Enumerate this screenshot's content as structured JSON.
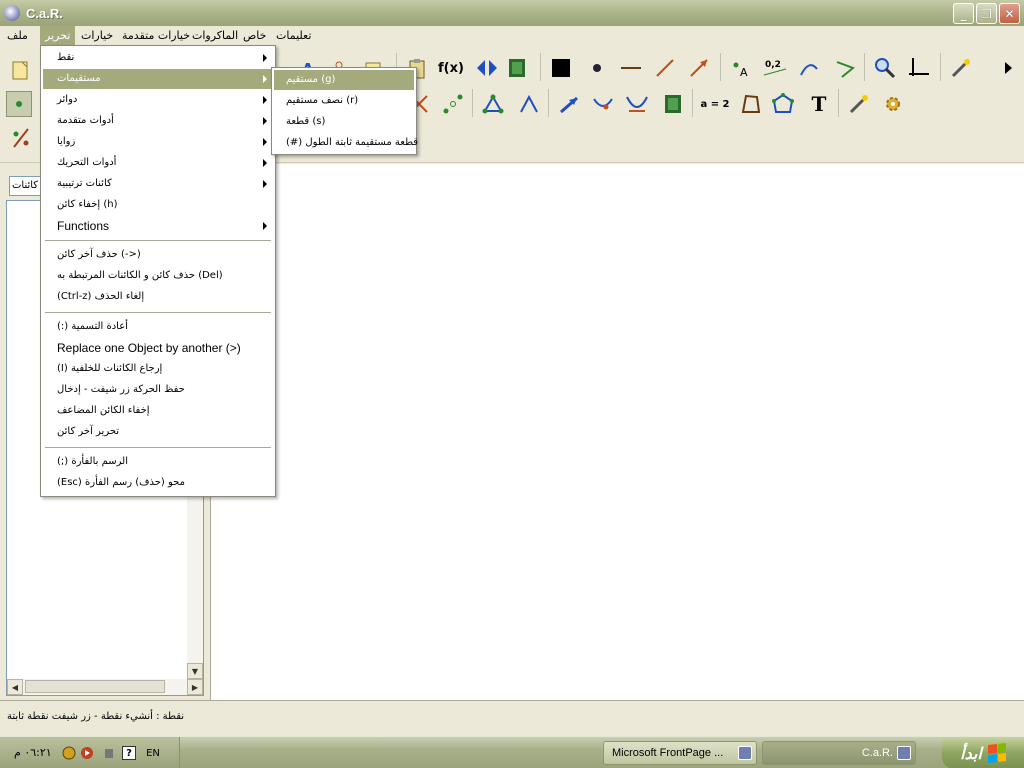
{
  "window": {
    "title": "C.a.R.",
    "min_label": "_",
    "max_label": "❐",
    "close_label": "✕"
  },
  "menubar": {
    "items": [
      "ملف",
      "تحرير",
      "خيارات",
      "خيارات متقدمة",
      "الماكروات",
      "خاص",
      "تعليمات"
    ]
  },
  "edit_menu": {
    "items": [
      "نقط",
      "مستقيمات",
      "دوائر",
      "أدوات متقدمة",
      "زوايا",
      "أدوات التحريك",
      "كائنات ترتيبية",
      "إخفاء كائن (h)",
      "Functions",
      "حذف آخر كائن     (->)",
      "حذف كائن و الكائنات المرتبطة به (Del)",
      "(Ctrl-z)         إلغاء الحذف",
      "(:) أعادة التسمية",
      "Replace one Object by another (>)",
      "(I) إرجاع الكائنات للخلفية",
      "حفظ الحركة زر شيفت - إدخال",
      "إخفاء الكائن المضاعف",
      "تحرير آخر كائن",
      "(;) الرسم بالفأرة",
      "(Esc)     محو (حذف) رسم الفأرة"
    ]
  },
  "lines_submenu": {
    "items": [
      "مستقيم (g)",
      "نصف مستقيم (r)",
      "قطعة (s)",
      "(#) قطعة مستقيمة ثابتة الطول"
    ]
  },
  "left_panel": {
    "combo_value": "كائنات"
  },
  "toolbar": {
    "fx_label": "f(x)",
    "a_eq_label": "a = 2",
    "text_tool_label": "T",
    "coord_label": "0,2",
    "point_a_label": "A"
  },
  "statusbar": {
    "text": "نقطة : أنشيء نقطة - زر شيفت نقطة ثابتة"
  },
  "taskbar": {
    "clock": "٠٦:٢١ م",
    "lang": "EN",
    "task_car": "C.a.R.",
    "task_frontpage": "Microsoft FrontPage ...",
    "start_label": "ابدأ"
  },
  "colors": {
    "accent": "#a4aa7c",
    "title_bar": "#aab38a",
    "canvas": "#ffffff"
  }
}
